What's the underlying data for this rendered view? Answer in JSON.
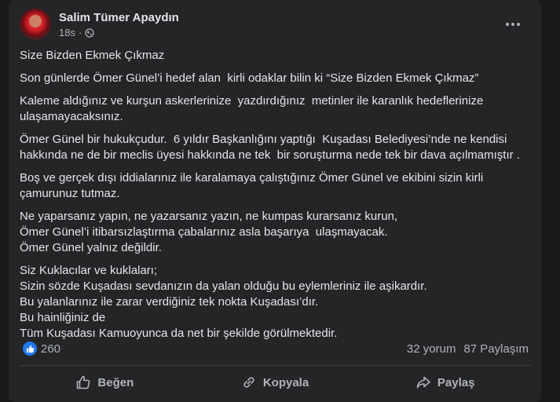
{
  "post": {
    "author": "Salim Tümer Apaydın",
    "time": "18s",
    "separator": "·",
    "paragraphs": [
      "Size Bizden Ekmek Çıkmaz",
      "Son günlerde Ömer Günel’i hedef alan  kirli odaklar bilin ki “Size Bizden Ekmek Çıkmaz”",
      "Kaleme aldığınız ve kurşun askerlerinize  yazdırdığınız  metinler ile karanlık hedeflerinize\nulaşamayacaksınız.",
      "Ömer Günel bir hukukçudur.  6 yıldır Başkanlığını yaptığı  Kuşadası Belediyesi’nde ne kendisi\nhakkında ne de bir meclis üyesi hakkında ne tek  bir soruşturma nede tek bir dava açılmamıştır .",
      "Boş ve gerçek dışı iddialarınız ile karalamaya çalıştığınız Ömer Günel ve ekibini sizin kirli\nçamurunuz tutmaz.",
      "Ne yaparsanız yapın, ne yazarsanız yazın, ne kumpas kurarsanız kurun,\nÖmer Günel’i itibarsızlaştırma çabalarınız asla başarıya  ulaşmayacak.\nÖmer Günel yalnız değildir.",
      "Siz Kuklacılar ve kuklaları;\nSizin sözde Kuşadası sevdanızın da yalan olduğu bu eylemleriniz ile aşikardır.\nBu yalanlarınız ile zarar verdiğiniz tek nokta Kuşadası’dır.\nBu hainliğiniz de\nTüm Kuşadası Kamuoyunca da net bir şekilde görülmektedir."
    ]
  },
  "stats": {
    "likes": "260",
    "comments": "32 yorum",
    "shares": "87 Paylaşım"
  },
  "actions": {
    "like": "Beğen",
    "copy": "Kopyala",
    "share": "Paylaş"
  },
  "icons": {
    "like_badge": "thumbs-up-icon",
    "more": "more-horizontal-icon",
    "audience": "globe-icon"
  },
  "colors": {
    "background": "#18191a",
    "card": "#242526",
    "text": "#e4e6eb",
    "secondary_text": "#b0b3b8",
    "like_blue": "#2078f4"
  }
}
